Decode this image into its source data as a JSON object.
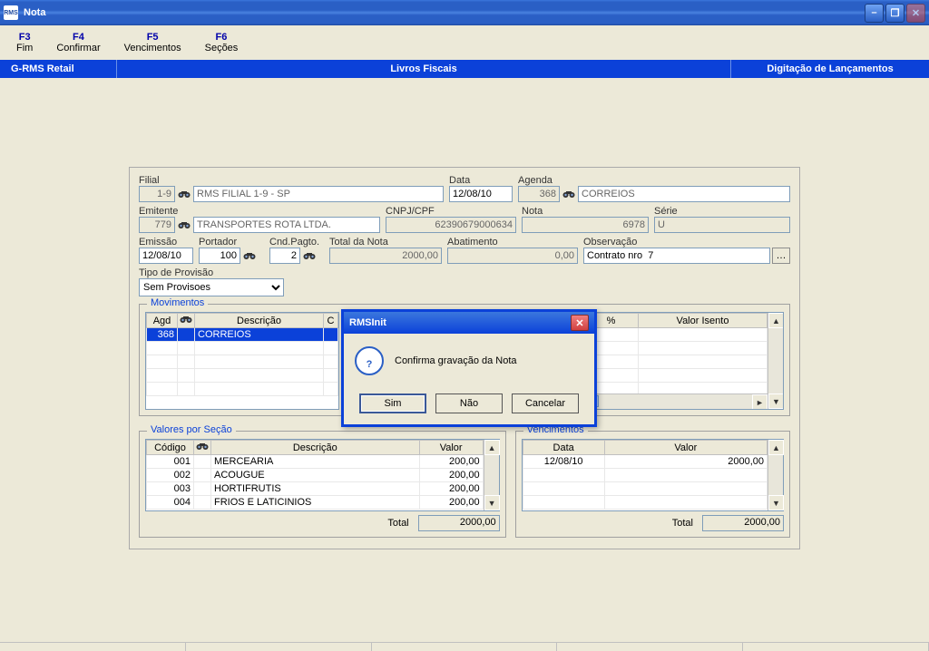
{
  "window": {
    "title": "Nota",
    "app_badge": "RMS"
  },
  "fkeys": [
    {
      "key": "F3",
      "label": "Fim"
    },
    {
      "key": "F4",
      "label": "Confirmar"
    },
    {
      "key": "F5",
      "label": "Vencimentos"
    },
    {
      "key": "F6",
      "label": "Seções"
    }
  ],
  "ribbon": {
    "left": "G-RMS Retail",
    "center": "Livros Fiscais",
    "right": "Digitação de Lançamentos"
  },
  "form": {
    "filial": {
      "label": "Filial",
      "code": "1-9",
      "name": "RMS FILIAL 1-9 - SP"
    },
    "data": {
      "label": "Data",
      "value": "12/08/10"
    },
    "agenda": {
      "label": "Agenda",
      "code": "368",
      "name": "CORREIOS"
    },
    "emitente": {
      "label": "Emitente",
      "code": "779",
      "name": "TRANSPORTES ROTA LTDA."
    },
    "cnpj": {
      "label": "CNPJ/CPF",
      "value": "62390679000634"
    },
    "nota": {
      "label": "Nota",
      "value": "6978"
    },
    "serie": {
      "label": "Série",
      "value": "U"
    },
    "emissao": {
      "label": "Emissão",
      "value": "12/08/10"
    },
    "portador": {
      "label": "Portador",
      "value": "100"
    },
    "cndpagto": {
      "label": "Cnd.Pagto.",
      "value": "2"
    },
    "total_nota": {
      "label": "Total da Nota",
      "value": "2000,00"
    },
    "abatimento": {
      "label": "Abatimento",
      "value": "0,00"
    },
    "observacao": {
      "label": "Observação",
      "value": "Contrato nro  7"
    },
    "tipo_provisao": {
      "label": "Tipo de Provisão",
      "value": "Sem Provisoes"
    }
  },
  "movimentos": {
    "legend": "Movimentos",
    "headers": {
      "agd": "Agd",
      "descricao": "Descrição",
      "c": "C",
      "pct": "%",
      "valor_isento": "Valor Isento"
    },
    "rows": [
      {
        "agd": "368",
        "descricao": "CORREIOS"
      }
    ]
  },
  "valores_secao": {
    "legend": "Valores por Seção",
    "headers": {
      "codigo": "Código",
      "descricao": "Descrição",
      "valor": "Valor"
    },
    "rows": [
      {
        "codigo": "001",
        "descricao": "MERCEARIA",
        "valor": "200,00"
      },
      {
        "codigo": "002",
        "descricao": "ACOUGUE",
        "valor": "200,00"
      },
      {
        "codigo": "003",
        "descricao": "HORTIFRUTIS",
        "valor": "200,00"
      },
      {
        "codigo": "004",
        "descricao": "FRIOS E LATICINIOS",
        "valor": "200,00"
      }
    ],
    "total_label": "Total",
    "total": "2000,00"
  },
  "vencimentos": {
    "legend": "Vencimentos",
    "headers": {
      "data": "Data",
      "valor": "Valor"
    },
    "rows": [
      {
        "data": "12/08/10",
        "valor": "2000,00"
      }
    ],
    "total_label": "Total",
    "total": "2000,00"
  },
  "dialog": {
    "title": "RMSInit",
    "message": "Confirma gravação da Nota",
    "buttons": {
      "yes": "Sim",
      "no": "Não",
      "cancel": "Cancelar"
    }
  }
}
